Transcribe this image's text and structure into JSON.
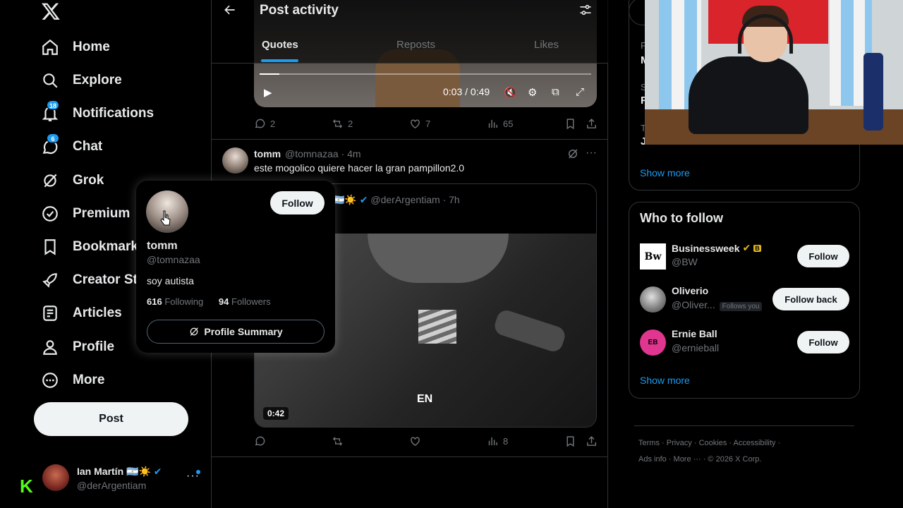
{
  "sidebar": {
    "nav": [
      {
        "label": "Home",
        "icon": "home-icon"
      },
      {
        "label": "Explore",
        "icon": "search-icon"
      },
      {
        "label": "Notifications",
        "icon": "bell-icon",
        "badge": "18"
      },
      {
        "label": "Chat",
        "icon": "chat-icon",
        "badge": "6"
      },
      {
        "label": "Grok",
        "icon": "grok-icon"
      },
      {
        "label": "Premium",
        "icon": "premium-icon"
      },
      {
        "label": "Bookmarks",
        "icon": "bookmark-icon"
      },
      {
        "label": "Creator Studio",
        "icon": "rocket-icon"
      },
      {
        "label": "Articles",
        "icon": "articles-icon"
      },
      {
        "label": "Profile",
        "icon": "person-icon"
      },
      {
        "label": "More",
        "icon": "more-circle-icon"
      }
    ],
    "post_label": "Post",
    "account": {
      "name": "Ian Martín 🇦🇷☀️",
      "handle": "@derArgentiam"
    }
  },
  "header": {
    "title": "Post activity",
    "tabs": [
      "Quotes",
      "Reposts",
      "Likes"
    ],
    "active_tab": "Quotes"
  },
  "video1": {
    "time": "0:03 / 0:49",
    "progress": 0.06
  },
  "action_row_1": {
    "replies": "2",
    "reposts": "2",
    "likes": "7",
    "views": "65"
  },
  "tweet": {
    "name": "tomm",
    "handle": "@tomnazaa · 4m",
    "text": "este mogolico quiere hacer la gran pampillon2.0",
    "quote": {
      "author_suffix": "🇦🇷☀️",
      "handle": "@derArgentiam · 7h",
      "video_duration": "0:42",
      "video_caption": "EN"
    }
  },
  "action_row_2": {
    "views": "8"
  },
  "hover_card": {
    "name": "tomm",
    "handle": "@tomnazaa",
    "bio": "soy autista",
    "following_count": "616",
    "following_label": "Following",
    "followers_count": "94",
    "followers_label": "Followers",
    "follow_label": "Follow",
    "summary_label": "Profile Summary"
  },
  "right": {
    "trend_fragments": [
      "P",
      "M",
      "S",
      "R",
      "T",
      "Jo"
    ],
    "show_more": "Show more",
    "who_to_follow": {
      "title": "Who to follow",
      "accounts": [
        {
          "name": "Businessweek",
          "handle": "@BW",
          "button": "Follow",
          "follows_you": ""
        },
        {
          "name": "Oliverio",
          "handle": "@Oliver...",
          "button": "Follow back",
          "follows_you": "Follows you"
        },
        {
          "name": "Ernie Ball",
          "handle": "@ernieball",
          "button": "Follow",
          "follows_you": ""
        }
      ],
      "show_more": "Show more"
    },
    "footer": {
      "line1": [
        "Terms",
        "Privacy",
        "Cookies",
        "Accessibility"
      ],
      "line2": [
        "Ads info",
        "More ···",
        "© 2026 X Corp."
      ]
    }
  },
  "colors": {
    "accent": "#1d9bf0",
    "bg": "#000000",
    "text": "#e7e9ea",
    "muted": "#71767b"
  }
}
